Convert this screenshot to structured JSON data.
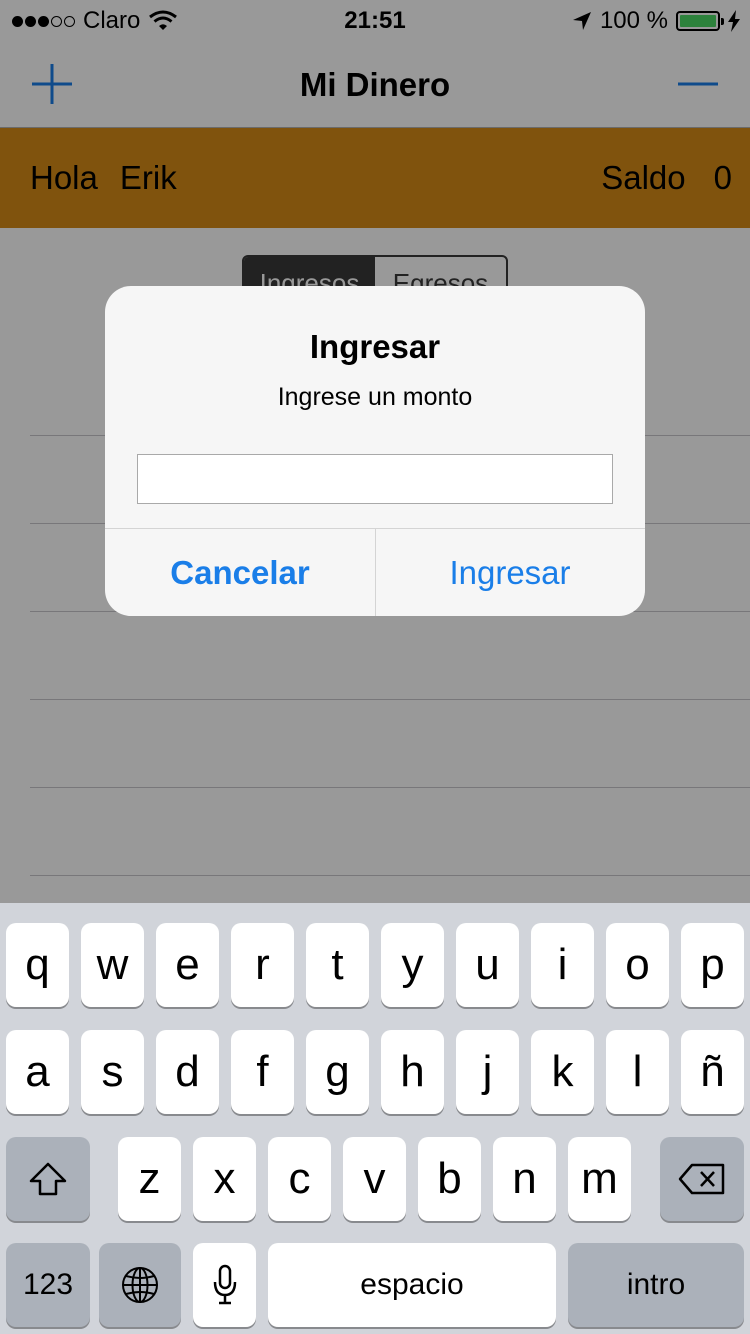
{
  "status_bar": {
    "carrier": "Claro",
    "time": "21:51",
    "battery": "100 %",
    "signal_icon": "signal-dots-icon",
    "wifi_icon": "wifi-icon",
    "location_icon": "location-arrow-icon",
    "battery_icon": "battery-icon",
    "charging_icon": "charging-bolt-icon"
  },
  "nav": {
    "title": "Mi Dinero",
    "add_icon": "plus-icon",
    "remove_icon": "minus-icon"
  },
  "greeting": {
    "hello": "Hola",
    "name": "Erik",
    "balance_label": "Saldo",
    "balance_value": "0",
    "color": "#d58a16"
  },
  "segmented": {
    "options": [
      "Ingresos",
      "Egresos"
    ],
    "selected": "Ingresos"
  },
  "alert": {
    "title": "Ingresar",
    "message": "Ingrese un monto",
    "input_value": "",
    "cancel_label": "Cancelar",
    "confirm_label": "Ingresar",
    "button_color": "#1a7ee8"
  },
  "keyboard": {
    "row1": [
      "q",
      "w",
      "e",
      "r",
      "t",
      "y",
      "u",
      "i",
      "o",
      "p"
    ],
    "row2": [
      "a",
      "s",
      "d",
      "f",
      "g",
      "h",
      "j",
      "k",
      "l",
      "ñ"
    ],
    "row3": [
      "z",
      "x",
      "c",
      "v",
      "b",
      "n",
      "m"
    ],
    "numbers_label": "123",
    "space_label": "espacio",
    "return_label": "intro",
    "shift_icon": "shift-icon",
    "delete_icon": "delete-icon",
    "globe_icon": "globe-icon",
    "mic_icon": "microphone-icon"
  }
}
